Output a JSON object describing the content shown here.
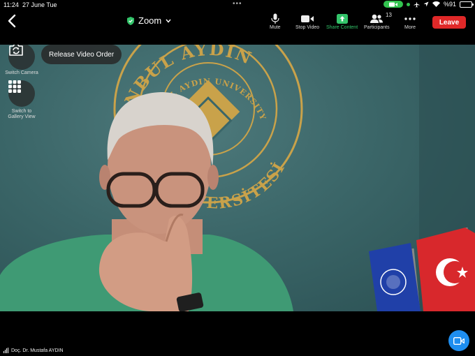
{
  "status_bar": {
    "time": "11:24",
    "date": "27 June Tue",
    "battery": "%91",
    "battery_level": 0.91
  },
  "toolbar": {
    "meeting_title": "Zoom",
    "mute_label": "Mute",
    "stop_video_label": "Stop Video",
    "share_content_label": "Share Content",
    "participants_label": "Participants",
    "participants_count": "13",
    "more_label": "More",
    "leave_label": "Leave"
  },
  "overlay": {
    "switch_camera_label": "Switch Camera",
    "release_video_order_label": "Release Video Order",
    "gallery_label_line1": "Switch to",
    "gallery_label_line2": "Gallery View"
  },
  "video": {
    "seal_top_text": "İSTANBUL AYDIN",
    "seal_inner_text": "İSTANBUL AYDIN UNIVERSITY",
    "seal_bottom_text": "ÜNİVERSİTESİ",
    "speaker_name": "Doç. Dr. Mustafa AYDIN"
  },
  "colors": {
    "leave": "#e02828",
    "share": "#33c46a",
    "video_toggle": "#1e8ef0",
    "wall": "#3b6668",
    "seal": "#c9a24a"
  },
  "icons": [
    "back-chevron-icon",
    "shield-check-icon",
    "chevron-down-icon",
    "microphone-icon",
    "video-camera-icon",
    "share-arrow-icon",
    "participants-icon",
    "more-dots-icon",
    "switch-camera-icon",
    "gallery-grid-icon",
    "signal-bars-icon",
    "video-camera-icon"
  ]
}
